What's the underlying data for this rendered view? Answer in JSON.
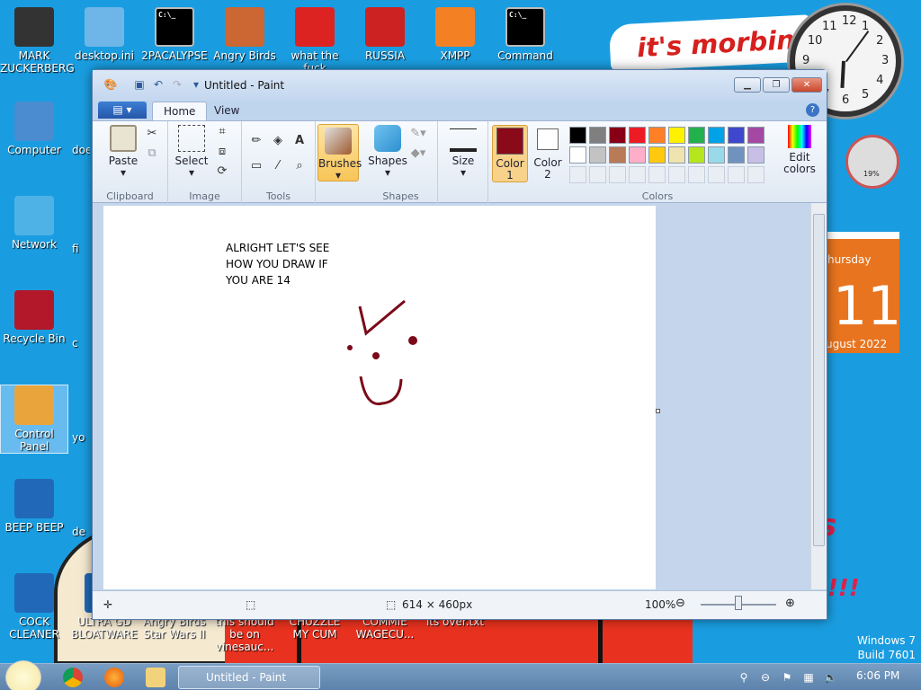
{
  "desktop": {
    "icons": [
      {
        "label": "MARK ZUCKERBERG",
        "icon": "person-icon"
      },
      {
        "label": "desktop.ini",
        "icon": "settings-file-icon"
      },
      {
        "label": "2PACALYPSE",
        "icon": "terminal-icon"
      },
      {
        "label": "Angry Birds",
        "icon": "game-icon"
      },
      {
        "label": "what the fuck",
        "icon": "angry-bird-icon"
      },
      {
        "label": "RUSSIA",
        "icon": "radiation-icon"
      },
      {
        "label": "XMPP",
        "icon": "xampp-icon"
      },
      {
        "label": "Command",
        "icon": "terminal-icon"
      },
      {
        "label": "Computer",
        "icon": "computer-icon"
      },
      {
        "label": "Network",
        "icon": "network-icon"
      },
      {
        "label": "Recycle Bin",
        "icon": "recycle-bin-icon"
      },
      {
        "label": "Control Panel",
        "icon": "control-panel-icon"
      },
      {
        "label": "BEEP BEEP",
        "icon": "app-icon"
      },
      {
        "label": "COCK CLEANER",
        "icon": "app-icon"
      },
      {
        "label": "ULTRA GD BLOATWARE",
        "icon": "app-icon"
      },
      {
        "label": "Angry Birds Star Wars II",
        "icon": "game-icon"
      },
      {
        "label": "this should be on vinesauc...",
        "icon": "file-icon"
      },
      {
        "label": "CHUZZLE MY CUM",
        "icon": "game-icon"
      },
      {
        "label": "COMMIE WAGECU...",
        "icon": "file-icon"
      },
      {
        "label": "its over.txt",
        "icon": "text-file-icon"
      }
    ],
    "partial_labels": [
      "doe",
      "fi",
      "c",
      "yo",
      "de"
    ],
    "banner_text": "it's morbin",
    "clock_numbers": [
      "12",
      "1",
      "2",
      "3",
      "4",
      "5",
      "6",
      "7",
      "8",
      "9",
      "10",
      "11"
    ],
    "clock_time": {
      "hour": 6,
      "minute": 6
    },
    "gauge_percent": "19%",
    "calendar": {
      "day_name": "hursday",
      "day": "11",
      "month": "ugust 2022"
    },
    "windows_version": {
      "line1": "Windows 7",
      "line2": "Build 7601"
    }
  },
  "paint": {
    "title": "Untitled - Paint",
    "file_menu": "▤ ▾",
    "tabs": [
      "Home",
      "View"
    ],
    "groups": {
      "clipboard": {
        "label": "Clipboard",
        "paste": "Paste"
      },
      "image": {
        "label": "Image",
        "select": "Select"
      },
      "tools": {
        "label": "Tools",
        "text_tool": "A"
      },
      "brushes": {
        "label": "Brushes"
      },
      "shapes": {
        "label": "Shapes",
        "shapes": "Shapes"
      },
      "size": {
        "label": "Size"
      },
      "colors": {
        "label": "Colors",
        "color1": "Color",
        "color1_num": "1",
        "color2": "Color",
        "color2_num": "2",
        "edit": "Edit colors"
      }
    },
    "color1_value": "#8b0a1a",
    "color2_value": "#ffffff",
    "palette_row1": [
      "#000000",
      "#7f7f7f",
      "#880015",
      "#ed1c24",
      "#ff7f27",
      "#fff200",
      "#22b14c",
      "#00a2e8",
      "#3f48cc",
      "#a349a4"
    ],
    "palette_row2": [
      "#ffffff",
      "#c3c3c3",
      "#b97a57",
      "#ffaec9",
      "#ffc90e",
      "#efe4b0",
      "#b5e61d",
      "#99d9ea",
      "#7092be",
      "#c8bfe7"
    ],
    "canvas_note": [
      "ALRIGHT LET'S SEE",
      "HOW YOU DRAW IF",
      "YOU ARE 14"
    ],
    "drawing_color": "#7a0a18",
    "status": {
      "size": "614 × 460px",
      "zoom": "100%"
    }
  },
  "taskbar": {
    "task_label": "Untitled - Paint",
    "time": "6:06 PM"
  }
}
